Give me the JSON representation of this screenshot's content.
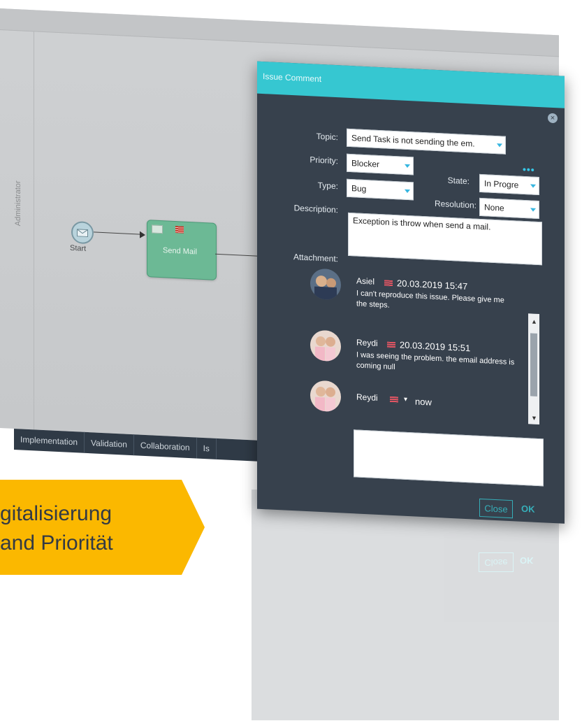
{
  "canvas": {
    "lane_label": "Administrator",
    "start_label": "Start",
    "task_label": "Send Mail"
  },
  "tabs": [
    "Implementation",
    "Validation",
    "Collaboration",
    "Is"
  ],
  "dialog": {
    "title": "Issue Comment",
    "labels": {
      "topic": "Topic:",
      "priority": "Priority:",
      "state": "State:",
      "type": "Type:",
      "resolution": "Resolution:",
      "description": "Description:",
      "attachment": "Attachment:"
    },
    "fields": {
      "topic": "Send Task is not sending the em.",
      "priority": "Blocker",
      "state": "In Progre",
      "type": "Bug",
      "resolution": "None",
      "description": "Exception is throw when send a mail."
    },
    "comments": [
      {
        "name": "Asiel",
        "date": "20.03.2019 15:47",
        "text": "I can't reproduce this issue. Please give me the steps."
      },
      {
        "name": "Reydi",
        "date": "20.03.2019 15:51",
        "text": "I was seeing the problem. the email address is coming null"
      }
    ],
    "new_comment": {
      "name": "Reydi",
      "time": "now"
    },
    "buttons": {
      "close": "Close",
      "ok": "OK"
    }
  },
  "banner": {
    "line1": "gitalisierung",
    "line2": "and Priorität",
    "color": "#fbb800"
  }
}
